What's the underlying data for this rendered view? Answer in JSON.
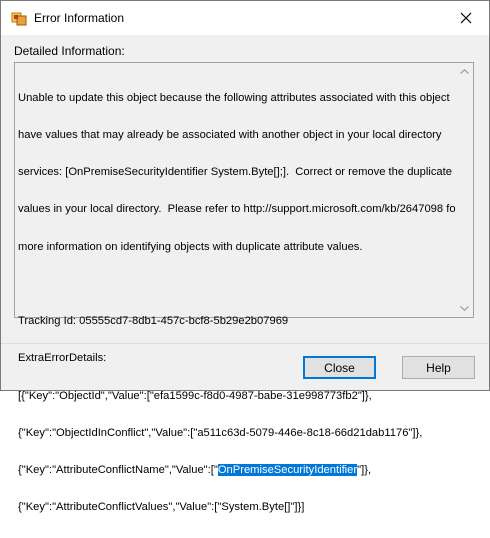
{
  "window": {
    "title": "Error Information",
    "close_icon": "close-icon"
  },
  "detail_label": "Detailed Information:",
  "message": {
    "lines_before": [
      "Unable to update this object because the following attributes associated with this object",
      "have values that may already be associated with another object in your local directory",
      "services: [OnPremiseSecurityIdentifier System.Byte[];].  Correct or remove the duplicate",
      "values in your local directory.  Please refer to http://support.microsoft.com/kb/2647098 for",
      "more information on identifying objects with duplicate attribute values.",
      "",
      "Tracking Id: 05555cd7-8db1-457c-bcf8-5b29e2b07969",
      "ExtraErrorDetails:",
      "[{\"Key\":\"ObjectId\",\"Value\":[\"efa1599c-f8d0-4987-babe-31e998773fb2\"]},",
      "{\"Key\":\"ObjectIdInConflict\",\"Value\":[\"a511c63d-5079-446e-8c18-66d21dab1176\"]},"
    ],
    "sel_prefix": "{\"Key\":\"AttributeConflictName\",\"Value\":[\"",
    "sel_text": "OnPremiseSecurityIdentifier",
    "sel_suffix": "\"]},",
    "last_line": "{\"Key\":\"AttributeConflictValues\",\"Value\":[\"System.Byte[]\"]}]"
  },
  "buttons": {
    "close": "Close",
    "help": "Help"
  }
}
